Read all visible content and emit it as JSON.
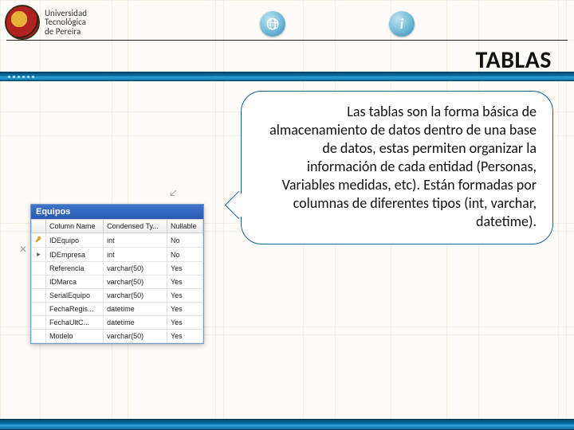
{
  "header": {
    "university_line1": "Universidad",
    "university_line2": "Tecnológica",
    "university_line3": "de Pereira",
    "title": "TABLAS"
  },
  "bubble": {
    "text": "Las tablas son la forma básica de almacenamiento de datos dentro de una base de datos, estas permiten organizar la información de cada entidad (Personas, Variables medidas, etc). Están formadas por columnas de diferentes tipos (int, varchar, datetime)."
  },
  "db_window": {
    "title": "Equipos",
    "columns": [
      "",
      "Column Name",
      "Condensed Ty...",
      "Nullable"
    ],
    "rows": [
      {
        "icon": "key",
        "name": "IDEquipo",
        "type": "int",
        "nullable": "No"
      },
      {
        "icon": "arrow",
        "name": "IDEmpresa",
        "type": "int",
        "nullable": "No"
      },
      {
        "icon": "",
        "name": "Referencia",
        "type": "varchar(50)",
        "nullable": "Yes"
      },
      {
        "icon": "",
        "name": "IDMarca",
        "type": "varchar(50)",
        "nullable": "Yes"
      },
      {
        "icon": "",
        "name": "SerialEquipo",
        "type": "varchar(50)",
        "nullable": "Yes"
      },
      {
        "icon": "",
        "name": "FechaRegis...",
        "type": "datetime",
        "nullable": "Yes"
      },
      {
        "icon": "",
        "name": "FechaUltC...",
        "type": "datetime",
        "nullable": "Yes"
      },
      {
        "icon": "",
        "name": "Modelo",
        "type": "varchar(50)",
        "nullable": "Yes"
      }
    ]
  }
}
